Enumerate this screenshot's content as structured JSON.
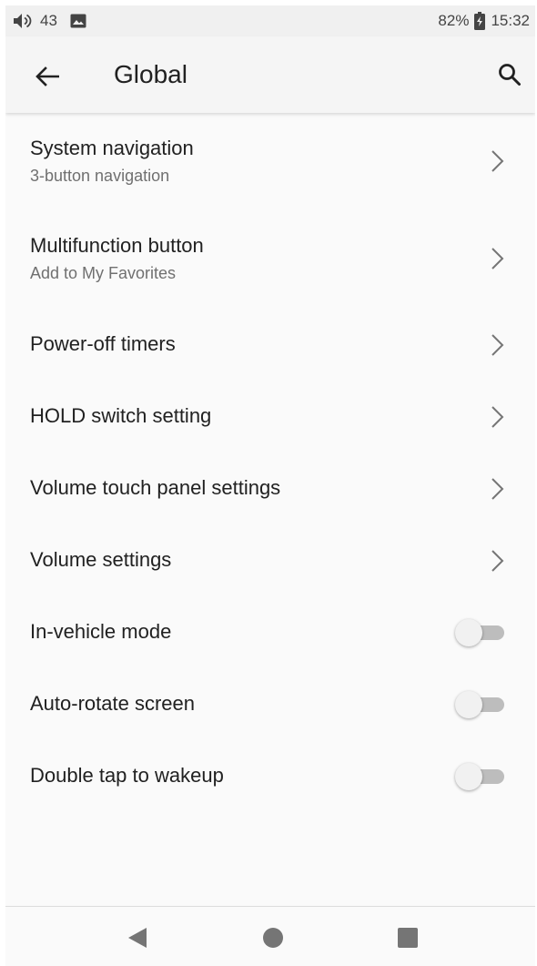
{
  "status_bar": {
    "volume_level": "43",
    "battery_percent": "82%",
    "time": "15:32"
  },
  "app_bar": {
    "title": "Global"
  },
  "settings": [
    {
      "label": "System navigation",
      "subtitle": "3-button navigation",
      "type": "chevron"
    },
    {
      "label": "Multifunction button",
      "subtitle": "Add to My Favorites",
      "type": "chevron"
    },
    {
      "label": "Power-off timers",
      "type": "chevron"
    },
    {
      "label": "HOLD switch setting",
      "type": "chevron"
    },
    {
      "label": "Volume touch panel settings",
      "type": "chevron"
    },
    {
      "label": "Volume settings",
      "type": "chevron"
    },
    {
      "label": "In-vehicle mode",
      "type": "toggle",
      "on": false
    },
    {
      "label": "Auto-rotate screen",
      "type": "toggle",
      "on": false
    },
    {
      "label": "Double tap to wakeup",
      "type": "toggle",
      "on": false
    }
  ],
  "icons": {
    "volume": "volume-icon",
    "image": "image-icon",
    "battery": "battery-charging-icon",
    "back": "arrow-back-icon",
    "search": "search-icon",
    "chevron": "chevron-right-icon",
    "nav_back": "nav-back-icon",
    "nav_home": "nav-home-icon",
    "nav_recent": "nav-recent-icon"
  },
  "colors": {
    "text_primary": "#212121",
    "text_secondary": "#707070",
    "toggle_track_off": "#bdbdbd",
    "toggle_thumb_off": "#f1f1f1",
    "nav_icon": "#757575"
  }
}
